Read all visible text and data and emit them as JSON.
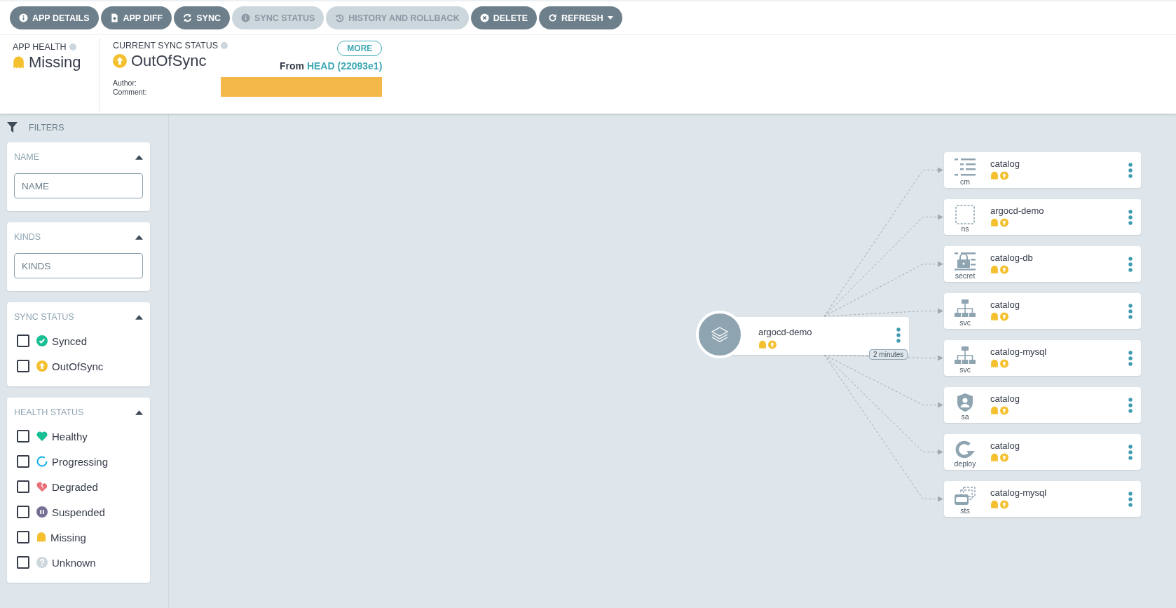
{
  "toolbar": [
    {
      "label": "APP DETAILS",
      "kind": "info",
      "disabled": false,
      "dropdown": false
    },
    {
      "label": "APP DIFF",
      "kind": "file",
      "disabled": false,
      "dropdown": false
    },
    {
      "label": "SYNC",
      "kind": "sync",
      "disabled": false,
      "dropdown": false
    },
    {
      "label": "SYNC STATUS",
      "kind": "info",
      "disabled": true,
      "dropdown": false
    },
    {
      "label": "HISTORY AND ROLLBACK",
      "kind": "history",
      "disabled": true,
      "dropdown": false
    },
    {
      "label": "DELETE",
      "kind": "delete",
      "disabled": false,
      "dropdown": false
    },
    {
      "label": "REFRESH",
      "kind": "refresh",
      "disabled": false,
      "dropdown": true
    }
  ],
  "header": {
    "app_health": {
      "label": "APP HEALTH",
      "value": "Missing"
    },
    "sync_status": {
      "label": "CURRENT SYNC STATUS",
      "value": "OutOfSync"
    },
    "more_button": "MORE",
    "from_label": "From",
    "revision": "HEAD (22093e1)",
    "author_label": "Author:",
    "comment_label": "Comment:"
  },
  "filters": {
    "title": "FILTERS",
    "name": {
      "title": "NAME",
      "placeholder": "NAME"
    },
    "kinds": {
      "title": "KINDS",
      "placeholder": "KINDS"
    },
    "sync_status": {
      "title": "SYNC STATUS",
      "options": [
        {
          "label": "Synced",
          "kind": "synced",
          "checked": false
        },
        {
          "label": "OutOfSync",
          "kind": "outofsync",
          "checked": false
        }
      ]
    },
    "health_status": {
      "title": "HEALTH STATUS",
      "options": [
        {
          "label": "Healthy",
          "kind": "healthy",
          "checked": false
        },
        {
          "label": "Progressing",
          "kind": "progressing",
          "checked": false
        },
        {
          "label": "Degraded",
          "kind": "degraded",
          "checked": false
        },
        {
          "label": "Suspended",
          "kind": "suspended",
          "checked": false
        },
        {
          "label": "Missing",
          "kind": "missing",
          "checked": false
        },
        {
          "label": "Unknown",
          "kind": "unknown",
          "checked": false
        }
      ]
    }
  },
  "graph": {
    "root": {
      "name": "argocd-demo",
      "missing": true,
      "out_of_sync": true,
      "age": "2 minutes"
    },
    "resources": [
      {
        "kind": "cm",
        "name": "catalog",
        "missing": true,
        "out_of_sync": true
      },
      {
        "kind": "ns",
        "name": "argocd-demo",
        "missing": true,
        "out_of_sync": true
      },
      {
        "kind": "secret",
        "name": "catalog-db",
        "missing": true,
        "out_of_sync": true
      },
      {
        "kind": "svc",
        "name": "catalog",
        "missing": true,
        "out_of_sync": true
      },
      {
        "kind": "svc",
        "name": "catalog-mysql",
        "missing": true,
        "out_of_sync": true
      },
      {
        "kind": "sa",
        "name": "catalog",
        "missing": true,
        "out_of_sync": true
      },
      {
        "kind": "deploy",
        "name": "catalog",
        "missing": true,
        "out_of_sync": true
      },
      {
        "kind": "sts",
        "name": "catalog-mysql",
        "missing": true,
        "out_of_sync": true
      }
    ]
  }
}
